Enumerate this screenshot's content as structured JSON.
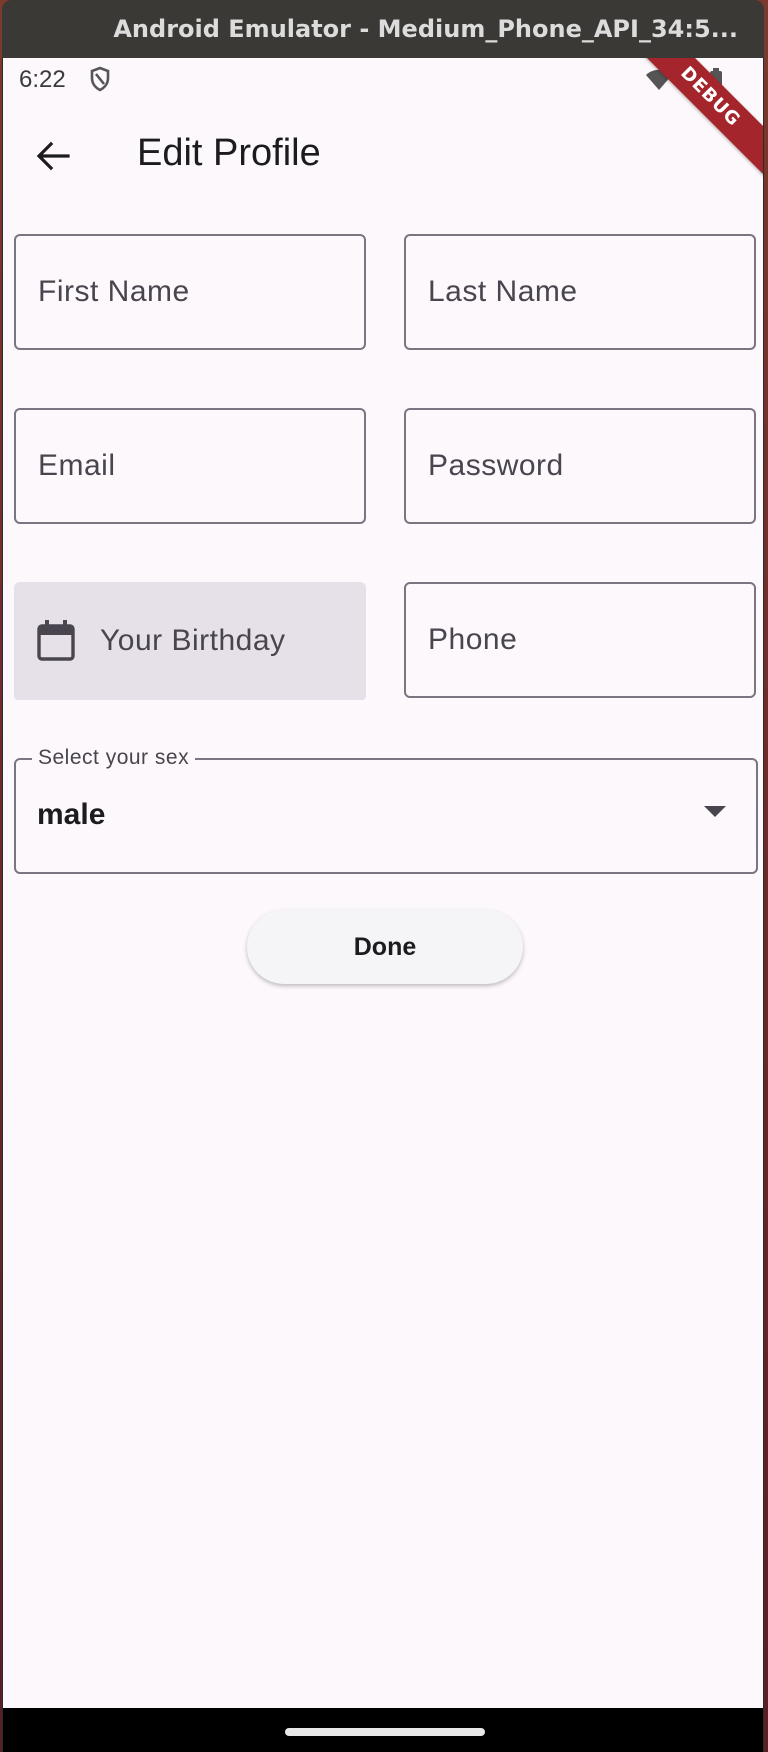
{
  "window": {
    "title": "Android Emulator - Medium_Phone_API_34:5..."
  },
  "status_bar": {
    "time": "6:22"
  },
  "debug_banner": "DEBUG",
  "app_bar": {
    "title": "Edit Profile"
  },
  "form": {
    "first_name": {
      "placeholder": "First Name",
      "value": ""
    },
    "last_name": {
      "placeholder": "Last Name",
      "value": ""
    },
    "email": {
      "placeholder": "Email",
      "value": ""
    },
    "password": {
      "placeholder": "Password",
      "value": ""
    },
    "birthday": {
      "label": "Your Birthday"
    },
    "phone": {
      "placeholder": "Phone",
      "value": ""
    },
    "sex": {
      "label": "Select your sex",
      "selected": "male"
    },
    "done_label": "Done"
  },
  "colors": {
    "background": "#fdf8fb",
    "outline": "#7a7580",
    "filled_field": "#e6e0e9",
    "debug_banner": "#a4262c"
  }
}
